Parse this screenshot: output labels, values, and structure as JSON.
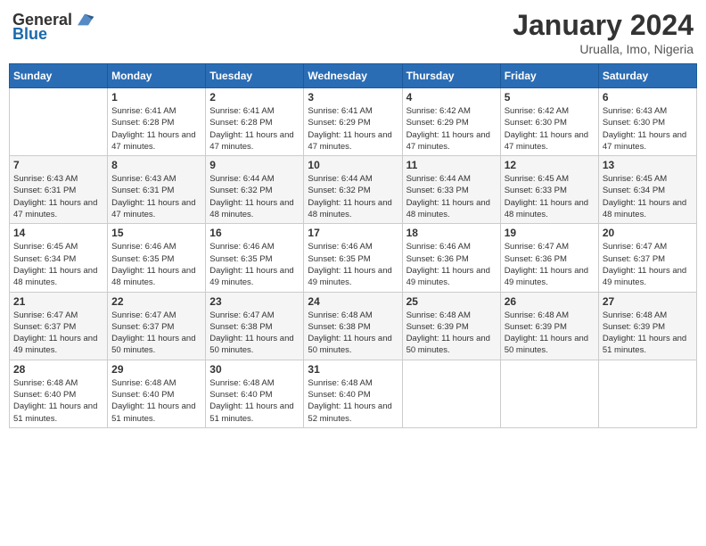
{
  "header": {
    "logo_general": "General",
    "logo_blue": "Blue",
    "month": "January 2024",
    "location": "Urualla, Imo, Nigeria"
  },
  "weekdays": [
    "Sunday",
    "Monday",
    "Tuesday",
    "Wednesday",
    "Thursday",
    "Friday",
    "Saturday"
  ],
  "weeks": [
    [
      {
        "day": "",
        "sunrise": "",
        "sunset": "",
        "daylight": ""
      },
      {
        "day": "1",
        "sunrise": "Sunrise: 6:41 AM",
        "sunset": "Sunset: 6:28 PM",
        "daylight": "Daylight: 11 hours and 47 minutes."
      },
      {
        "day": "2",
        "sunrise": "Sunrise: 6:41 AM",
        "sunset": "Sunset: 6:28 PM",
        "daylight": "Daylight: 11 hours and 47 minutes."
      },
      {
        "day": "3",
        "sunrise": "Sunrise: 6:41 AM",
        "sunset": "Sunset: 6:29 PM",
        "daylight": "Daylight: 11 hours and 47 minutes."
      },
      {
        "day": "4",
        "sunrise": "Sunrise: 6:42 AM",
        "sunset": "Sunset: 6:29 PM",
        "daylight": "Daylight: 11 hours and 47 minutes."
      },
      {
        "day": "5",
        "sunrise": "Sunrise: 6:42 AM",
        "sunset": "Sunset: 6:30 PM",
        "daylight": "Daylight: 11 hours and 47 minutes."
      },
      {
        "day": "6",
        "sunrise": "Sunrise: 6:43 AM",
        "sunset": "Sunset: 6:30 PM",
        "daylight": "Daylight: 11 hours and 47 minutes."
      }
    ],
    [
      {
        "day": "7",
        "sunrise": "Sunrise: 6:43 AM",
        "sunset": "Sunset: 6:31 PM",
        "daylight": "Daylight: 11 hours and 47 minutes."
      },
      {
        "day": "8",
        "sunrise": "Sunrise: 6:43 AM",
        "sunset": "Sunset: 6:31 PM",
        "daylight": "Daylight: 11 hours and 47 minutes."
      },
      {
        "day": "9",
        "sunrise": "Sunrise: 6:44 AM",
        "sunset": "Sunset: 6:32 PM",
        "daylight": "Daylight: 11 hours and 48 minutes."
      },
      {
        "day": "10",
        "sunrise": "Sunrise: 6:44 AM",
        "sunset": "Sunset: 6:32 PM",
        "daylight": "Daylight: 11 hours and 48 minutes."
      },
      {
        "day": "11",
        "sunrise": "Sunrise: 6:44 AM",
        "sunset": "Sunset: 6:33 PM",
        "daylight": "Daylight: 11 hours and 48 minutes."
      },
      {
        "day": "12",
        "sunrise": "Sunrise: 6:45 AM",
        "sunset": "Sunset: 6:33 PM",
        "daylight": "Daylight: 11 hours and 48 minutes."
      },
      {
        "day": "13",
        "sunrise": "Sunrise: 6:45 AM",
        "sunset": "Sunset: 6:34 PM",
        "daylight": "Daylight: 11 hours and 48 minutes."
      }
    ],
    [
      {
        "day": "14",
        "sunrise": "Sunrise: 6:45 AM",
        "sunset": "Sunset: 6:34 PM",
        "daylight": "Daylight: 11 hours and 48 minutes."
      },
      {
        "day": "15",
        "sunrise": "Sunrise: 6:46 AM",
        "sunset": "Sunset: 6:35 PM",
        "daylight": "Daylight: 11 hours and 48 minutes."
      },
      {
        "day": "16",
        "sunrise": "Sunrise: 6:46 AM",
        "sunset": "Sunset: 6:35 PM",
        "daylight": "Daylight: 11 hours and 49 minutes."
      },
      {
        "day": "17",
        "sunrise": "Sunrise: 6:46 AM",
        "sunset": "Sunset: 6:35 PM",
        "daylight": "Daylight: 11 hours and 49 minutes."
      },
      {
        "day": "18",
        "sunrise": "Sunrise: 6:46 AM",
        "sunset": "Sunset: 6:36 PM",
        "daylight": "Daylight: 11 hours and 49 minutes."
      },
      {
        "day": "19",
        "sunrise": "Sunrise: 6:47 AM",
        "sunset": "Sunset: 6:36 PM",
        "daylight": "Daylight: 11 hours and 49 minutes."
      },
      {
        "day": "20",
        "sunrise": "Sunrise: 6:47 AM",
        "sunset": "Sunset: 6:37 PM",
        "daylight": "Daylight: 11 hours and 49 minutes."
      }
    ],
    [
      {
        "day": "21",
        "sunrise": "Sunrise: 6:47 AM",
        "sunset": "Sunset: 6:37 PM",
        "daylight": "Daylight: 11 hours and 49 minutes."
      },
      {
        "day": "22",
        "sunrise": "Sunrise: 6:47 AM",
        "sunset": "Sunset: 6:37 PM",
        "daylight": "Daylight: 11 hours and 50 minutes."
      },
      {
        "day": "23",
        "sunrise": "Sunrise: 6:47 AM",
        "sunset": "Sunset: 6:38 PM",
        "daylight": "Daylight: 11 hours and 50 minutes."
      },
      {
        "day": "24",
        "sunrise": "Sunrise: 6:48 AM",
        "sunset": "Sunset: 6:38 PM",
        "daylight": "Daylight: 11 hours and 50 minutes."
      },
      {
        "day": "25",
        "sunrise": "Sunrise: 6:48 AM",
        "sunset": "Sunset: 6:39 PM",
        "daylight": "Daylight: 11 hours and 50 minutes."
      },
      {
        "day": "26",
        "sunrise": "Sunrise: 6:48 AM",
        "sunset": "Sunset: 6:39 PM",
        "daylight": "Daylight: 11 hours and 50 minutes."
      },
      {
        "day": "27",
        "sunrise": "Sunrise: 6:48 AM",
        "sunset": "Sunset: 6:39 PM",
        "daylight": "Daylight: 11 hours and 51 minutes."
      }
    ],
    [
      {
        "day": "28",
        "sunrise": "Sunrise: 6:48 AM",
        "sunset": "Sunset: 6:40 PM",
        "daylight": "Daylight: 11 hours and 51 minutes."
      },
      {
        "day": "29",
        "sunrise": "Sunrise: 6:48 AM",
        "sunset": "Sunset: 6:40 PM",
        "daylight": "Daylight: 11 hours and 51 minutes."
      },
      {
        "day": "30",
        "sunrise": "Sunrise: 6:48 AM",
        "sunset": "Sunset: 6:40 PM",
        "daylight": "Daylight: 11 hours and 51 minutes."
      },
      {
        "day": "31",
        "sunrise": "Sunrise: 6:48 AM",
        "sunset": "Sunset: 6:40 PM",
        "daylight": "Daylight: 11 hours and 52 minutes."
      },
      {
        "day": "",
        "sunrise": "",
        "sunset": "",
        "daylight": ""
      },
      {
        "day": "",
        "sunrise": "",
        "sunset": "",
        "daylight": ""
      },
      {
        "day": "",
        "sunrise": "",
        "sunset": "",
        "daylight": ""
      }
    ]
  ]
}
